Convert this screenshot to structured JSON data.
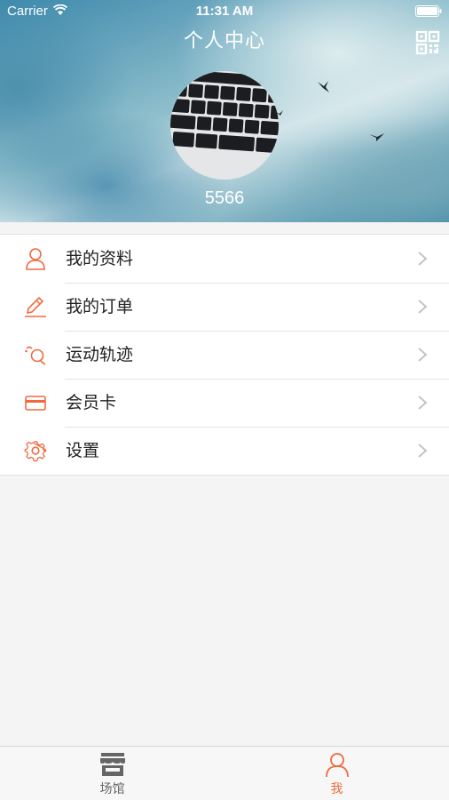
{
  "status_bar": {
    "carrier": "Carrier",
    "time": "11:31 AM"
  },
  "header": {
    "title": "个人中心",
    "username": "5566"
  },
  "menu": [
    {
      "label": "我的资料",
      "icon": "user-icon"
    },
    {
      "label": "我的订单",
      "icon": "edit-icon"
    },
    {
      "label": "运动轨迹",
      "icon": "track-icon"
    },
    {
      "label": "会员卡",
      "icon": "card-icon"
    },
    {
      "label": "设置",
      "icon": "gear-icon"
    }
  ],
  "tabbar": [
    {
      "label": "场馆",
      "icon": "store-icon",
      "active": false
    },
    {
      "label": "我",
      "icon": "user-icon",
      "active": true
    }
  ],
  "colors": {
    "accent": "#f06a3f",
    "inactive": "#666666"
  }
}
